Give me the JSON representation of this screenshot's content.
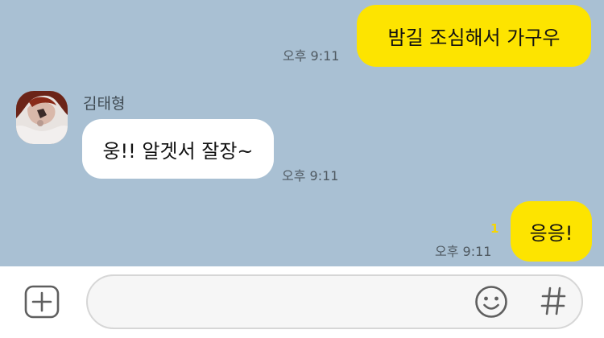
{
  "messages": [
    {
      "text": "밤길 조심해서 가구우",
      "time": "오후 9:11"
    },
    {
      "sender": "김태형",
      "text": "웅!! 알겟서 잘장~",
      "time": "오후 9:11"
    },
    {
      "text": "응응!",
      "time": "오후 9:11",
      "unread": "1"
    }
  ],
  "input": {
    "placeholder": ""
  },
  "icons": {
    "add": "plus-square-icon",
    "emoji": "smiley-icon",
    "hash": "hashtag-icon"
  },
  "colors": {
    "chat_background": "#a9c0d3",
    "my_bubble": "#fde400",
    "their_bubble": "#ffffff",
    "unread_count": "#f7d600"
  }
}
